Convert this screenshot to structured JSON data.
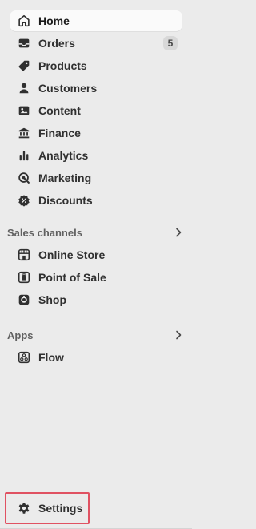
{
  "nav": {
    "items": [
      {
        "label": "Home",
        "icon": "home-icon"
      },
      {
        "label": "Orders",
        "icon": "inbox-icon",
        "badge": "5"
      },
      {
        "label": "Products",
        "icon": "tag-icon"
      },
      {
        "label": "Customers",
        "icon": "person-icon"
      },
      {
        "label": "Content",
        "icon": "image-icon"
      },
      {
        "label": "Finance",
        "icon": "bank-icon"
      },
      {
        "label": "Analytics",
        "icon": "bar-chart-icon"
      },
      {
        "label": "Marketing",
        "icon": "target-icon"
      },
      {
        "label": "Discounts",
        "icon": "discount-icon"
      }
    ]
  },
  "sales_channels": {
    "title": "Sales channels",
    "items": [
      {
        "label": "Online Store",
        "icon": "storefront-icon"
      },
      {
        "label": "Point of Sale",
        "icon": "pos-icon"
      },
      {
        "label": "Shop",
        "icon": "shop-icon"
      }
    ]
  },
  "apps": {
    "title": "Apps",
    "items": [
      {
        "label": "Flow",
        "icon": "flow-icon"
      }
    ]
  },
  "settings": {
    "label": "Settings",
    "icon": "gear-icon"
  },
  "colors": {
    "background": "#ebebeb",
    "active_item": "#fafafa",
    "badge": "#d8d8d8",
    "highlight_border": "#e05262"
  }
}
